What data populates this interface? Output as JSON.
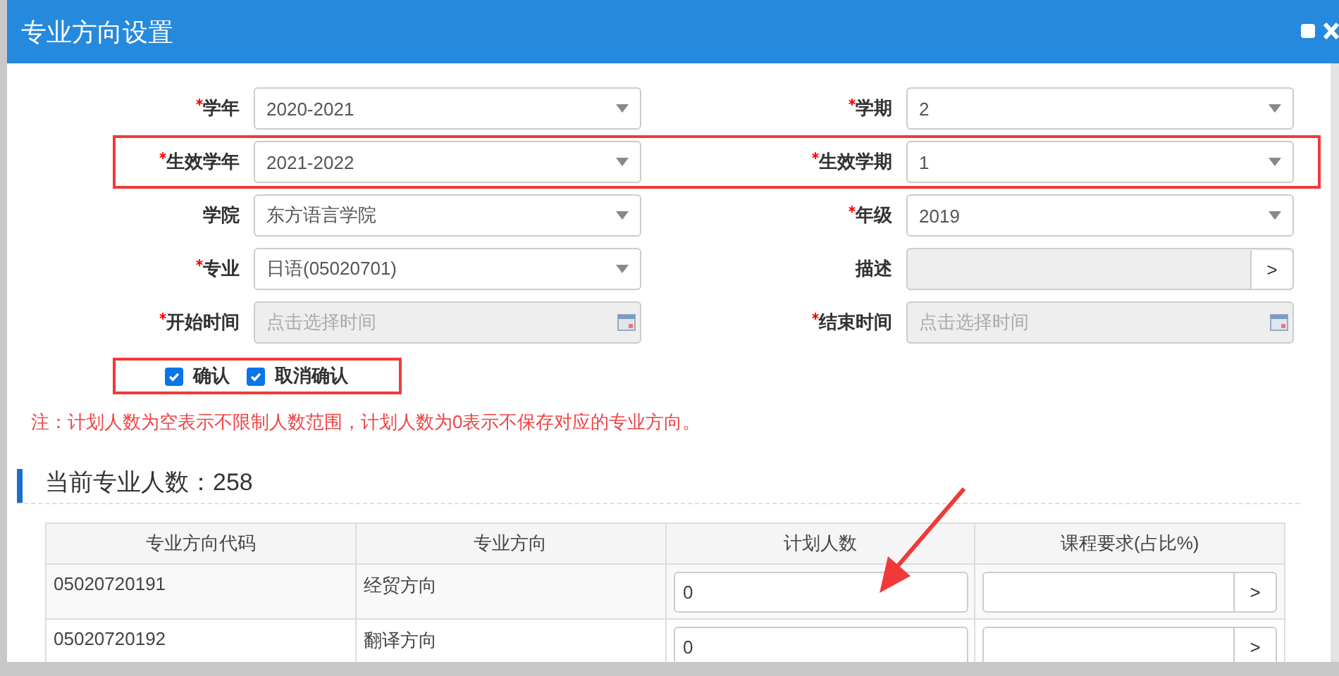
{
  "window": {
    "title": "专业方向设置"
  },
  "form_rows": [
    {
      "highlighted": false,
      "fields": [
        {
          "label": "学年",
          "required": true,
          "kind": "select",
          "disabled": false,
          "value": "2020-2021"
        },
        {
          "label": "学期",
          "required": true,
          "kind": "select",
          "disabled": false,
          "value": "2"
        }
      ]
    },
    {
      "highlighted": true,
      "fields": [
        {
          "label": "生效学年",
          "required": true,
          "kind": "select",
          "disabled": false,
          "value": "2021-2022"
        },
        {
          "label": "生效学期",
          "required": true,
          "kind": "select",
          "disabled": false,
          "value": "1"
        }
      ]
    },
    {
      "highlighted": false,
      "fields": [
        {
          "label": "学院",
          "required": false,
          "kind": "select",
          "disabled": false,
          "value": "东方语言学院"
        },
        {
          "label": "年级",
          "required": true,
          "kind": "select",
          "disabled": false,
          "value": "2019"
        }
      ]
    },
    {
      "highlighted": false,
      "fields": [
        {
          "label": "专业",
          "required": true,
          "kind": "select",
          "disabled": false,
          "value": "日语(05020701)"
        },
        {
          "label": "描述",
          "required": false,
          "kind": "picker",
          "disabled": true,
          "button": ">"
        }
      ]
    },
    {
      "highlighted": false,
      "fields": [
        {
          "label": "开始时间",
          "required": true,
          "kind": "date",
          "disabled": true,
          "placeholder": "点击选择时间"
        },
        {
          "label": "结束时间",
          "required": true,
          "kind": "date",
          "disabled": true,
          "placeholder": "点击选择时间"
        }
      ]
    }
  ],
  "checkboxes": {
    "highlighted": true,
    "items": [
      {
        "label": "确认",
        "checked": true
      },
      {
        "label": "取消确认",
        "checked": true
      }
    ]
  },
  "note": "注：计划人数为空表示不限制人数范围，计划人数为0表示不保存对应的专业方向。",
  "section": {
    "title": "当前专业人数：258"
  },
  "table": {
    "columns": [
      "专业方向代码",
      "专业方向",
      "计划人数",
      "课程要求(占比%)"
    ],
    "rows": [
      {
        "code": "05020720191",
        "direction": "经贸方向",
        "planned": "0",
        "requirement_button": ">"
      },
      {
        "code": "05020720192",
        "direction": "翻译方向",
        "planned": "0",
        "requirement_button": ">"
      }
    ]
  }
}
